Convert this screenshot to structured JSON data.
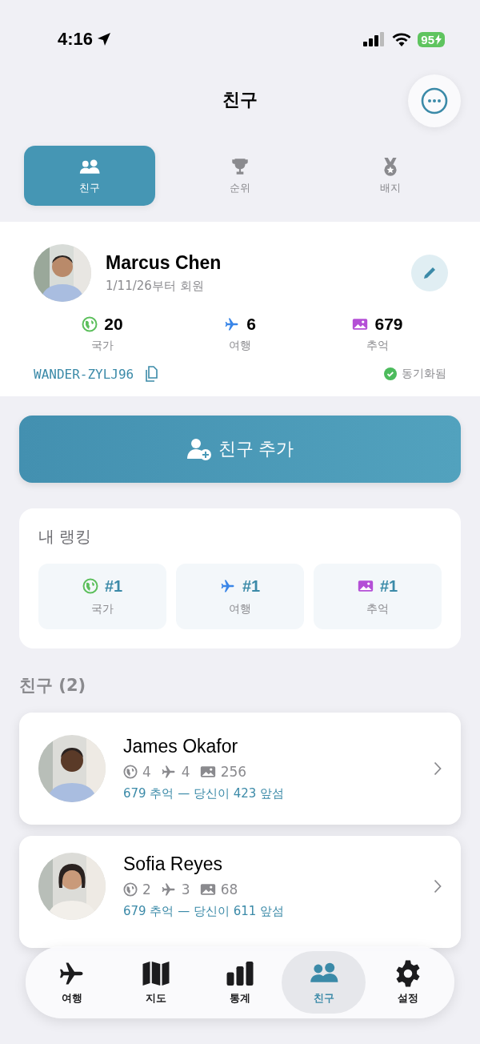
{
  "status_bar": {
    "time": "4:16",
    "battery": "95"
  },
  "header": {
    "title": "친구"
  },
  "segments": [
    {
      "label": "친구",
      "kind": "friends",
      "selected": true
    },
    {
      "label": "순위",
      "kind": "trophy",
      "selected": false
    },
    {
      "label": "배지",
      "kind": "medal",
      "selected": false
    }
  ],
  "profile": {
    "name": "Marcus Chen",
    "member_since": "1/11/26부터 회원",
    "stats": [
      {
        "kind": "countries",
        "value": "20",
        "label": "국가"
      },
      {
        "kind": "trips",
        "value": "6",
        "label": "여행"
      },
      {
        "kind": "memories",
        "value": "679",
        "label": "추억"
      }
    ],
    "code": "WANDER-ZYLJ96",
    "sync_status": "동기화됨"
  },
  "add_friend_button": "친구 추가",
  "ranking": {
    "title": "내 랭킹",
    "items": [
      {
        "kind": "countries",
        "rank": "#1",
        "label": "국가"
      },
      {
        "kind": "trips",
        "rank": "#1",
        "label": "여행"
      },
      {
        "kind": "memories",
        "rank": "#1",
        "label": "추억"
      }
    ]
  },
  "friends_header": "친구 (2)",
  "friends": [
    {
      "name": "James Okafor",
      "countries": "4",
      "trips": "4",
      "memories": "256",
      "comparison": "679 추억 — 당신이 423 앞섬"
    },
    {
      "name": "Sofia Reyes",
      "countries": "2",
      "trips": "3",
      "memories": "68",
      "comparison": "679 추억 — 당신이 611 앞섬"
    }
  ],
  "tab_bar": [
    {
      "kind": "trips",
      "label": "여행",
      "selected": false
    },
    {
      "kind": "map",
      "label": "지도",
      "selected": false
    },
    {
      "kind": "stats",
      "label": "통계",
      "selected": false
    },
    {
      "kind": "friends",
      "label": "친구",
      "selected": true
    },
    {
      "kind": "settings",
      "label": "설정",
      "selected": false
    }
  ]
}
